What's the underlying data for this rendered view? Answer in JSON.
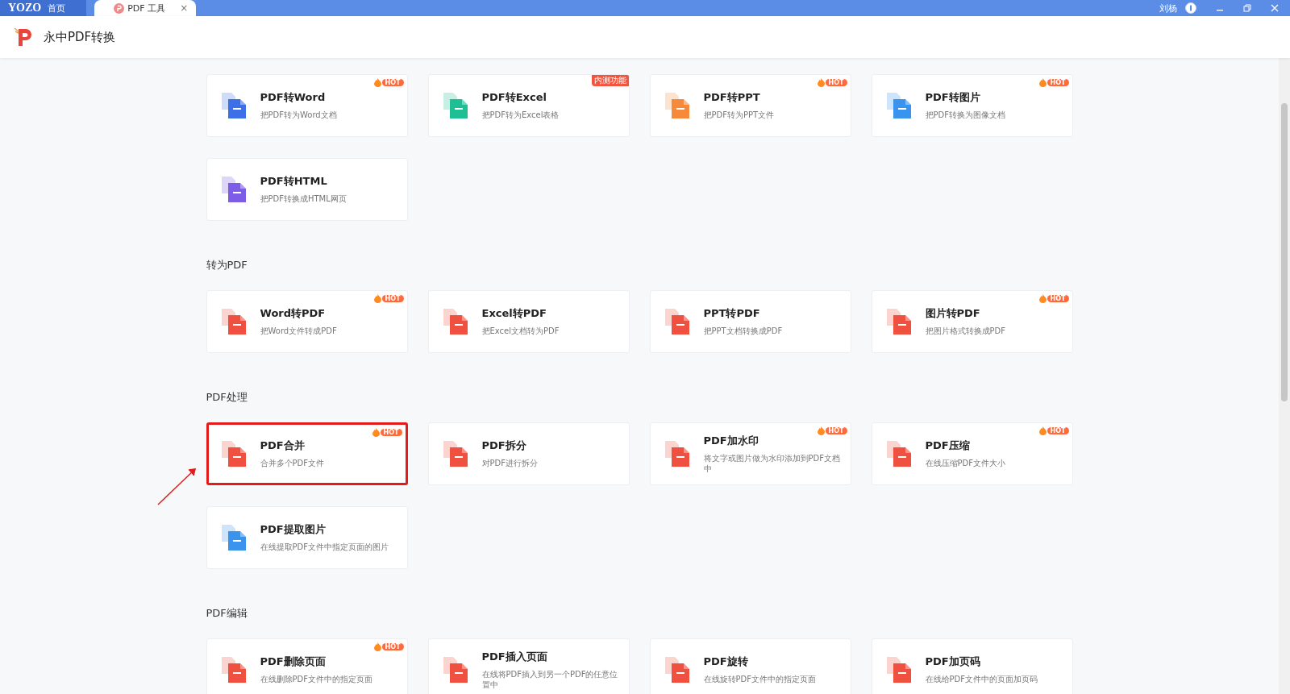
{
  "titlebar": {
    "home_tab": {
      "logo": "YOZO",
      "label": "首页"
    },
    "tabs": [
      {
        "label": "PDF 工具",
        "selected": true,
        "close": "×"
      }
    ],
    "user": "刘杨"
  },
  "app_header": {
    "title": "永中PDF转换"
  },
  "sections": [
    {
      "cards": [
        {
          "title": "PDF转Word",
          "desc": "把PDF转为Word文档",
          "color": "#3d6fe8",
          "badge": {
            "kind": "hot",
            "text": "HOT"
          },
          "highlighted": false
        },
        {
          "title": "PDF转Excel",
          "desc": "把PDF转为Excel表格",
          "color": "#1fbf95",
          "badge": {
            "kind": "beta",
            "text": "内测功能"
          },
          "highlighted": false
        },
        {
          "title": "PDF转PPT",
          "desc": "把PDF转为PPT文件",
          "color": "#f78a3a",
          "badge": {
            "kind": "hot",
            "text": "HOT"
          },
          "highlighted": false
        },
        {
          "title": "PDF转图片",
          "desc": "把PDF转换为图像文档",
          "color": "#3a93ec",
          "badge": {
            "kind": "hot",
            "text": "HOT"
          },
          "highlighted": false
        },
        {
          "title": "PDF转HTML",
          "desc": "把PDF转换成HTML网页",
          "color": "#7d5ce8",
          "highlighted": false
        }
      ]
    },
    {
      "title": "转为PDF",
      "cards": [
        {
          "title": "Word转PDF",
          "desc": "把Word文件转成PDF",
          "color": "#ef5040",
          "badge": {
            "kind": "hot",
            "text": "HOT"
          },
          "highlighted": false
        },
        {
          "title": "Excel转PDF",
          "desc": "把Excel文档转为PDF",
          "color": "#ef5040",
          "highlighted": false
        },
        {
          "title": "PPT转PDF",
          "desc": "把PPT文档转换成PDF",
          "color": "#ef5040",
          "highlighted": false
        },
        {
          "title": "图片转PDF",
          "desc": "把图片格式转换成PDF",
          "color": "#ef5040",
          "badge": {
            "kind": "hot",
            "text": "HOT"
          },
          "highlighted": false
        }
      ]
    },
    {
      "title": "PDF处理",
      "cards": [
        {
          "title": "PDF合并",
          "desc": "合并多个PDF文件",
          "color": "#ef5040",
          "badge": {
            "kind": "hot",
            "text": "HOT"
          },
          "highlighted": true
        },
        {
          "title": "PDF拆分",
          "desc": "对PDF进行拆分",
          "color": "#ef5040",
          "highlighted": false
        },
        {
          "title": "PDF加水印",
          "desc": "将文字或图片做为水印添加到PDF文档中",
          "color": "#ef5040",
          "badge": {
            "kind": "hot",
            "text": "HOT"
          },
          "highlighted": false
        },
        {
          "title": "PDF压缩",
          "desc": "在线压缩PDF文件大小",
          "color": "#ef5040",
          "badge": {
            "kind": "hot",
            "text": "HOT"
          },
          "highlighted": false
        },
        {
          "title": "PDF提取图片",
          "desc": "在线提取PDF文件中指定页面的图片",
          "color": "#3a93ec",
          "highlighted": false
        }
      ]
    },
    {
      "title": "PDF编辑",
      "cards": [
        {
          "title": "PDF删除页面",
          "desc": "在线删除PDF文件中的指定页面",
          "color": "#ef5040",
          "badge": {
            "kind": "hot",
            "text": "HOT"
          },
          "highlighted": false
        },
        {
          "title": "PDF插入页面",
          "desc": "在线将PDF插入到另一个PDF的任意位置中",
          "color": "#ef5040",
          "highlighted": false
        },
        {
          "title": "PDF旋转",
          "desc": "在线旋转PDF文件中的指定页面",
          "color": "#ef5040",
          "highlighted": false
        },
        {
          "title": "PDF加页码",
          "desc": "在线给PDF文件中的页面加页码",
          "color": "#ef5040",
          "highlighted": false
        }
      ]
    }
  ]
}
